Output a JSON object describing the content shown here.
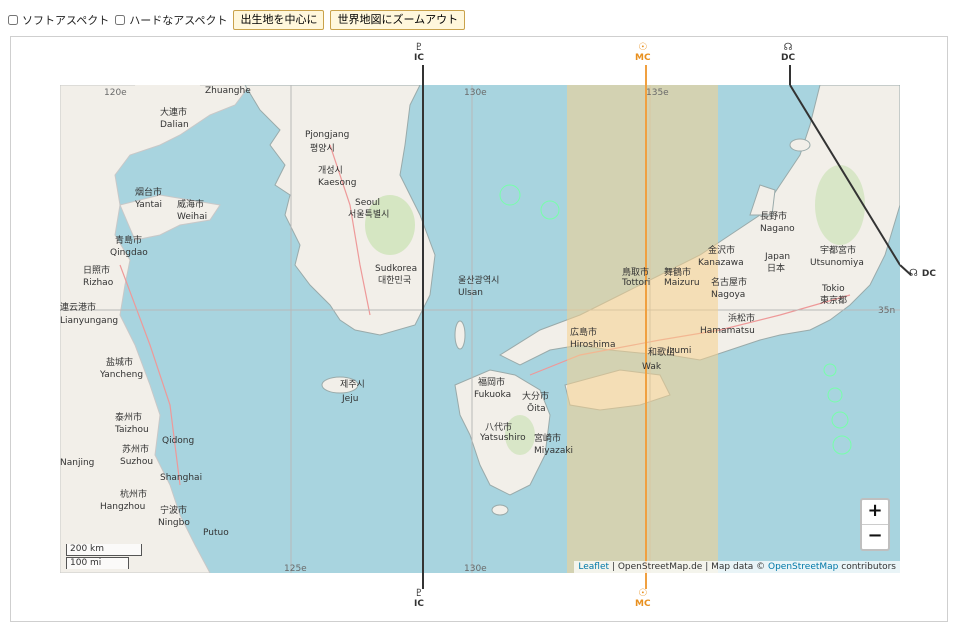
{
  "toolbar": {
    "soft_aspect_label": "ソフトアスペクト",
    "hard_aspect_label": "ハードなアスペクト",
    "center_birthplace_button": "出生地を中心に",
    "zoom_out_button": "世界地図にズームアウト",
    "soft_checked": false,
    "hard_checked": false
  },
  "map": {
    "graticule_labels": [
      "120e",
      "125e",
      "130e",
      "135e",
      "35n"
    ],
    "places": [
      "大連市",
      "Dalian",
      "Zhuanghe",
      "Pjongjang",
      "평양시",
      "개성시",
      "Kaesong",
      "Seoul",
      "서울특별시",
      "烟台市",
      "Yantai",
      "威海市",
      "Weihai",
      "青島市",
      "Qingdao",
      "日照市",
      "Rizhao",
      "連云港市",
      "Lianyungang",
      "Sudkorea",
      "대한민국",
      "울산광역시",
      "Ulsan",
      "Jeju",
      "제주시",
      "福岡市",
      "Fukuoka",
      "大分市",
      "Ōita",
      "広島市",
      "Hiroshima",
      "宮崎市",
      "Miyazaki",
      "八代市",
      "Yatsushiro",
      "名古屋市",
      "Nagoya",
      "浜松市",
      "Hamamatsu",
      "長野市",
      "Nagano",
      "宇都宮市",
      "Utsunomiya",
      "東京都",
      "Tokio",
      "金沢市",
      "Kanazawa",
      "Japan",
      "日本",
      "鳥取市",
      "Tottori",
      "舞鶴市",
      "Maizuru",
      "和歌山",
      "Wak",
      "Izumi",
      "泰州市",
      "Taizhou",
      "苏州市",
      "Suzhou",
      "杭州市",
      "Hangzhou",
      "宁波市",
      "Ningbo",
      "盐城市",
      "Yancheng",
      "Nanjing",
      "Putuo",
      "Qidong",
      "Shanghai"
    ],
    "colors": {
      "sea": "#a8d4df",
      "land": "#f2efe9",
      "mc_band": "#f5cf8c",
      "mc_line": "#f0a040",
      "ic_line": "#333333",
      "dc_line": "#333333"
    }
  },
  "lines": {
    "ic_top_symbol": "♇",
    "ic_top_label": "IC",
    "ic_bottom_symbol": "♇",
    "ic_bottom_label": "IC",
    "mc_top_symbol": "☉",
    "mc_top_label": "MC",
    "mc_bottom_symbol": "☉",
    "mc_bottom_label": "MC",
    "dc_top_symbol": "☊",
    "dc_top_label": "DC",
    "dc_right_symbol": "☊",
    "dc_right_label": "DC"
  },
  "controls": {
    "zoom_in": "+",
    "zoom_out": "−",
    "scale_km": "200 km",
    "scale_mi": "100 mi"
  },
  "attribution": {
    "leaflet": "Leaflet",
    "sep1": "|",
    "osm_de": "OpenStreetMap.de",
    "sep2": "|",
    "map_data": "Map data ©",
    "osm": "OpenStreetMap",
    "contributors": "contributors"
  }
}
